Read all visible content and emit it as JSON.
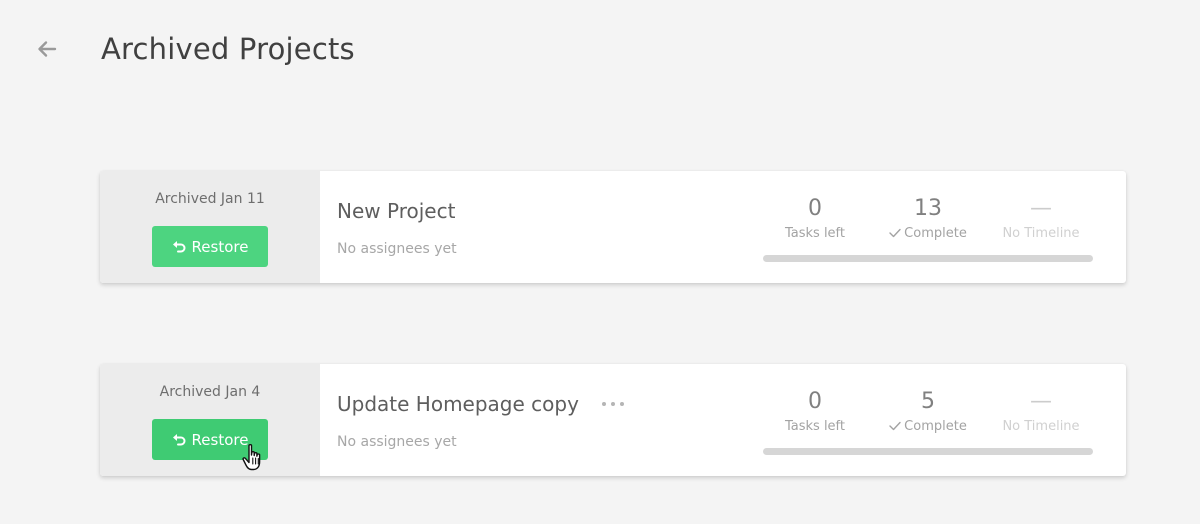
{
  "page": {
    "title": "Archived Projects",
    "back_icon": "arrow-left-icon"
  },
  "projects": [
    {
      "archived_label": "Archived Jan 11",
      "restore_label": "Restore",
      "name": "New Project",
      "assignees": "No assignees yet",
      "tasks_left_value": "0",
      "tasks_left_label": "Tasks left",
      "complete_value": "13",
      "complete_label": "Complete",
      "timeline_value": "—",
      "timeline_label": "No Timeline"
    },
    {
      "archived_label": "Archived Jan 4",
      "restore_label": "Restore",
      "name": "Update Homepage copy",
      "assignees": "No assignees yet",
      "tasks_left_value": "0",
      "tasks_left_label": "Tasks left",
      "complete_value": "5",
      "complete_label": "Complete",
      "timeline_value": "—",
      "timeline_label": "No Timeline"
    }
  ],
  "colors": {
    "restore_button": "#4dd480",
    "background": "#f4f4f4",
    "card_left_panel": "#ececec",
    "progress_track": "#d6d6d6"
  },
  "icons": {
    "restore": "undo-arrow-icon",
    "more": "more-horizontal-icon",
    "check": "checkmark-icon",
    "cursor": "hand-pointer-cursor-icon"
  }
}
